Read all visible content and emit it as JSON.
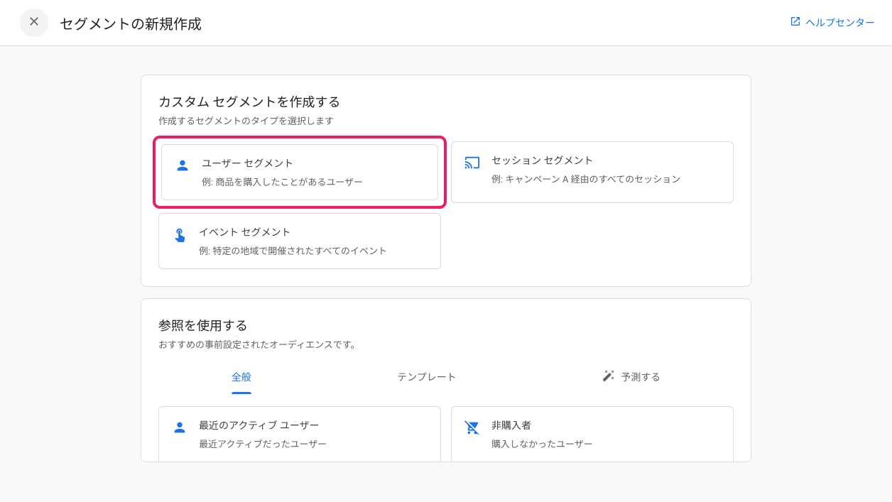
{
  "header": {
    "title": "セグメントの新規作成",
    "help_label": "ヘルプセンター"
  },
  "custom": {
    "title": "カスタム セグメントを作成する",
    "subtitle": "作成するセグメントのタイプを選択します",
    "options": [
      {
        "title": "ユーザー セグメント",
        "desc": "例: 商品を購入したことがあるユーザー"
      },
      {
        "title": "セッション セグメント",
        "desc": "例: キャンペーン A 経由のすべてのセッション"
      },
      {
        "title": "イベント セグメント",
        "desc": "例: 特定の地域で開催されたすべてのイベント"
      }
    ]
  },
  "reference": {
    "title": "参照を使用する",
    "subtitle": "おすすめの事前設定されたオーディエンスです。",
    "tabs": [
      {
        "label": "全般",
        "active": true
      },
      {
        "label": "テンプレート",
        "active": false
      },
      {
        "label": "予測する",
        "active": false,
        "icon": "magic"
      }
    ],
    "items": [
      {
        "title": "最近のアクティブ ユーザー",
        "desc": "最近アクティブだったユーザー"
      },
      {
        "title": "非購入者",
        "desc": "購入しなかったユーザー"
      }
    ]
  }
}
